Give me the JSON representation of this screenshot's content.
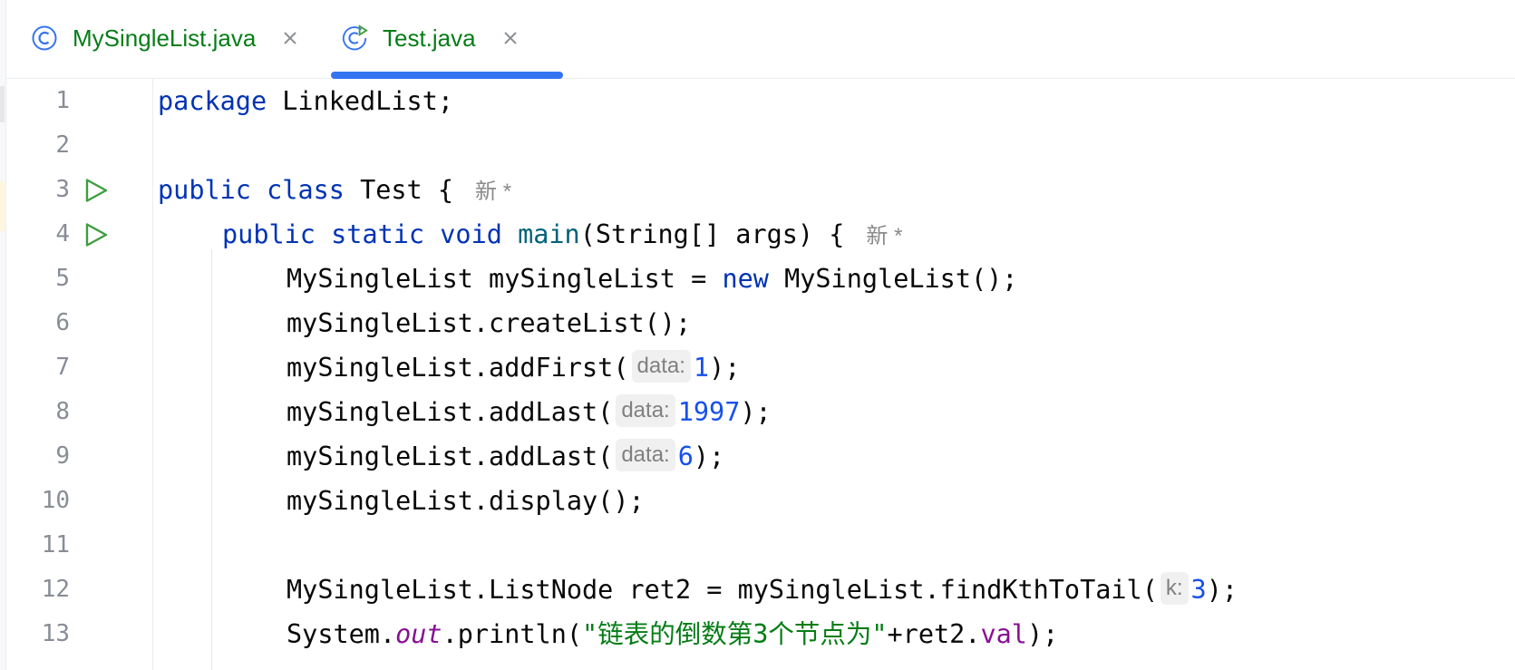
{
  "tabs": [
    {
      "label": "MySingleList.java",
      "icon": "class-icon",
      "active": false
    },
    {
      "label": "Test.java",
      "icon": "runnable-class-icon",
      "active": true
    }
  ],
  "author_hint": "新 *",
  "hints": {
    "data": "data:",
    "k": "k:"
  },
  "lines": {
    "n1": "1",
    "n2": "2",
    "n3": "3",
    "n4": "4",
    "n5": "5",
    "n6": "6",
    "n7": "7",
    "n8": "8",
    "n9": "9",
    "n10": "10",
    "n11": "11",
    "n12": "12",
    "n13": "13"
  },
  "code": {
    "l1_kw": "package",
    "l1_rest": " LinkedList;",
    "l3_kw1": "public",
    "l3_kw2": "class",
    "l3_rest": " Test {",
    "l4_kw1": "public",
    "l4_kw2": "static",
    "l4_kw3": "void",
    "l4_fn": "main",
    "l4_rest": "(String[] args) {",
    "l5_a": "MySingleList mySingleList = ",
    "l5_kw": "new",
    "l5_b": " MySingleList();",
    "l6": "mySingleList.createList();",
    "l7_a": "mySingleList.addFirst(",
    "l7_num": "1",
    "l7_b": ");",
    "l8_a": "mySingleList.addLast(",
    "l8_num": "1997",
    "l8_b": ");",
    "l9_a": "mySingleList.addLast(",
    "l9_num": "6",
    "l9_b": ");",
    "l10": "mySingleList.display();",
    "l12_a": "MySingleList.ListNode ret2 = mySingleList.findKthToTail(",
    "l12_num": "3",
    "l12_b": ");",
    "l13_a": "System.",
    "l13_field": "out",
    "l13_b": ".println(",
    "l13_str": "\"链表的倒数第3个节点为\"",
    "l13_c": "+ret2.",
    "l13_val": "val",
    "l13_d": ");"
  },
  "colors": {
    "keyword": "#0033b3",
    "number": "#1750eb",
    "string": "#067d17",
    "field": "#871094",
    "accent": "#3574f0"
  }
}
